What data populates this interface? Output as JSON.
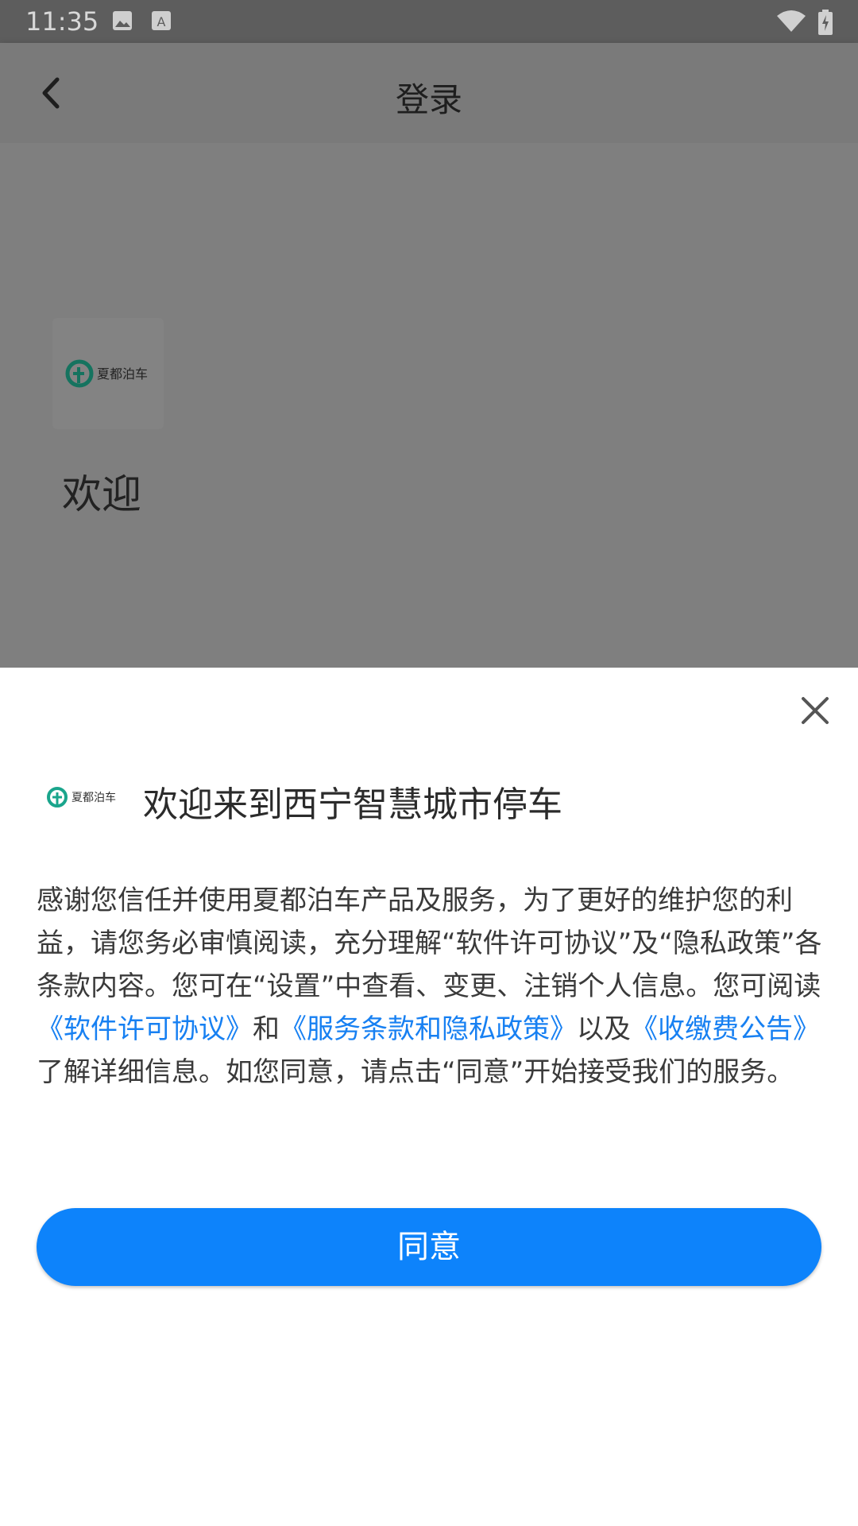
{
  "status_bar": {
    "time": "11:35",
    "icons": [
      "image-icon",
      "font-a-icon",
      "wifi-icon",
      "battery-charging-icon"
    ]
  },
  "app_bar": {
    "title": "登录",
    "back_icon": "chevron-left-icon"
  },
  "background": {
    "logo_name": "夏都泊车",
    "welcome_text": "欢迎"
  },
  "dialog": {
    "title": "欢迎来到西宁智慧城市停车",
    "logo_name": "夏都泊车",
    "close_icon": "close-icon",
    "body_segments": {
      "intro": "感谢您信任并使用夏都泊车产品及服务，为了更好的维护您的利益，请您务必审慎阅读，充分理解“软件许可协议”及“隐私政策”各条款内容。您可在“设置”中查看、变更、注销个人信息。您可阅读",
      "link_license": "《软件许可协议》",
      "and": "和",
      "link_privacy": "《服务条款和隐私政策》",
      "and_also": "以及",
      "link_fee": "《收缴费公告》",
      "outro": "了解详细信息。如您同意，请点击“同意”开始接受我们的服务。"
    },
    "agree_button": "同意"
  },
  "colors": {
    "primary": "#0d83fb",
    "link": "#1780f2",
    "logo_green": "#1aa58c"
  }
}
